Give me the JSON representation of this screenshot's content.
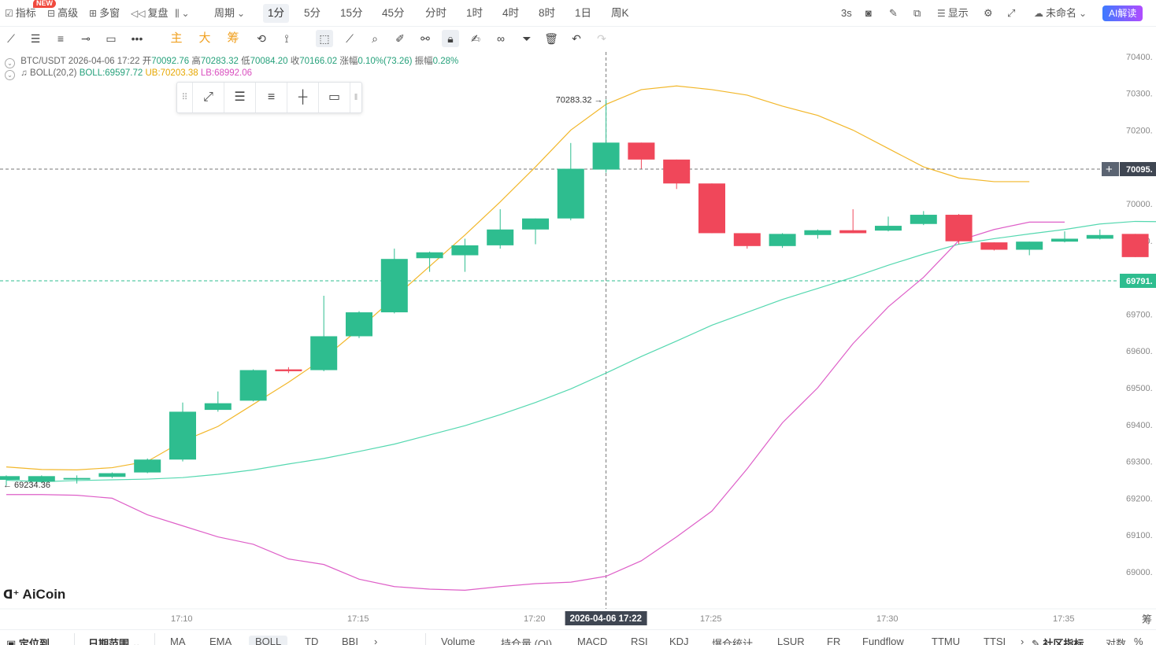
{
  "topbar": {
    "indicator": "指标",
    "new_badge": "NEW",
    "advanced": "高级",
    "multi_window": "多窗",
    "replay": "复盘",
    "period_label": "周期",
    "periods": [
      "1分",
      "5分",
      "15分",
      "45分",
      "分时",
      "1时",
      "4时",
      "8时",
      "1日",
      "周K"
    ],
    "active_period": "1分",
    "refresh": "3s",
    "display": "显示",
    "account": "未命名",
    "ai_button": "AI解读"
  },
  "toolbar2": {
    "main_label": "主",
    "big_label": "大",
    "chip_label": "筹"
  },
  "info": {
    "symbol": "BTC/USDT",
    "datetime": "2026-04-06 17:22",
    "open_label": "开",
    "open": "70092.76",
    "high_label": "高",
    "high": "70283.32",
    "low_label": "低",
    "low": "70084.20",
    "close_label": "收",
    "close": "70166.02",
    "change_label": "涨幅",
    "change": "0.10%(73.26)",
    "amp_label": "振幅",
    "amp": "0.28%",
    "boll_name": "BOLL(20,2)",
    "boll_mid": "BOLL:69597.72",
    "boll_ub": "UB:70203.38",
    "boll_lb": "LB:68992.06"
  },
  "chart_data": {
    "type": "candlestick",
    "symbol": "BTC/USDT",
    "ylim": [
      68900,
      70440
    ],
    "yticks": [
      70400,
      70300,
      70200,
      70000,
      69900,
      69700,
      69600,
      69500,
      69400,
      69300,
      69200,
      69100,
      69000
    ],
    "ytick_labels": [
      "70400.",
      "70300.",
      "70200.",
      "70000.",
      "69900.",
      "69700.",
      "69600.",
      "69500.",
      "69400.",
      "69300.",
      "69200.",
      "69100.",
      "69000."
    ],
    "xticks": [
      "17:10",
      "17:15",
      "17:20",
      "17:25",
      "17:30",
      "17:35"
    ],
    "crosshair_time": "2026-04-06 17:22",
    "crosshair_price_label": "70095.",
    "last_price_label": "69791.",
    "high_marker": "70283.32",
    "low_marker": "69234.36",
    "candles": [
      {
        "o": 69250,
        "h": 69262,
        "l": 69234.36,
        "c": 69260
      },
      {
        "o": 69245,
        "h": 69262,
        "l": 69242,
        "c": 69260
      },
      {
        "o": 69252,
        "h": 69262,
        "l": 69240,
        "c": 69255
      },
      {
        "o": 69258,
        "h": 69270,
        "l": 69255,
        "c": 69268
      },
      {
        "o": 69270,
        "h": 69308,
        "l": 69268,
        "c": 69305
      },
      {
        "o": 69305,
        "h": 69460,
        "l": 69300,
        "c": 69435
      },
      {
        "o": 69440,
        "h": 69490,
        "l": 69435,
        "c": 69458
      },
      {
        "o": 69465,
        "h": 69550,
        "l": 69463,
        "c": 69548
      },
      {
        "o": 69550,
        "h": 69556,
        "l": 69540,
        "c": 69545
      },
      {
        "o": 69548,
        "h": 69750,
        "l": 69545,
        "c": 69640
      },
      {
        "o": 69640,
        "h": 69708,
        "l": 69635,
        "c": 69705
      },
      {
        "o": 69705,
        "h": 69878,
        "l": 69702,
        "c": 69850
      },
      {
        "o": 69852,
        "h": 69870,
        "l": 69815,
        "c": 69868
      },
      {
        "o": 69860,
        "h": 69905,
        "l": 69815,
        "c": 69887
      },
      {
        "o": 69887,
        "h": 69985,
        "l": 69878,
        "c": 69930
      },
      {
        "o": 69930,
        "h": 69960,
        "l": 69890,
        "c": 69960
      },
      {
        "o": 69960,
        "h": 70165,
        "l": 69955,
        "c": 70095
      },
      {
        "o": 70092.76,
        "h": 70283.32,
        "l": 70084.2,
        "c": 70166.02
      },
      {
        "o": 70166,
        "h": 70166,
        "l": 70095,
        "c": 70120
      },
      {
        "o": 70120,
        "h": 70120,
        "l": 70040,
        "c": 70055
      },
      {
        "o": 70055,
        "h": 70055,
        "l": 69920,
        "c": 69920
      },
      {
        "o": 69920,
        "h": 69920,
        "l": 69878,
        "c": 69885
      },
      {
        "o": 69885,
        "h": 69920,
        "l": 69880,
        "c": 69918
      },
      {
        "o": 69915,
        "h": 69930,
        "l": 69905,
        "c": 69928
      },
      {
        "o": 69928,
        "h": 69985,
        "l": 69920,
        "c": 69920
      },
      {
        "o": 69927,
        "h": 69965,
        "l": 69925,
        "c": 69940
      },
      {
        "o": 69945,
        "h": 69980,
        "l": 69942,
        "c": 69970
      },
      {
        "o": 69970,
        "h": 69972,
        "l": 69890,
        "c": 69898
      },
      {
        "o": 69895,
        "h": 69895,
        "l": 69873,
        "c": 69875
      },
      {
        "o": 69875,
        "h": 69897,
        "l": 69860,
        "c": 69897
      },
      {
        "o": 69897,
        "h": 69925,
        "l": 69895,
        "c": 69905
      },
      {
        "o": 69905,
        "h": 69930,
        "l": 69903,
        "c": 69915
      },
      {
        "o": 69918,
        "h": 69918,
        "l": 69855,
        "c": 69855
      }
    ],
    "boll_mid": [
      69249,
      69245,
      69248,
      69250,
      69252,
      69256,
      69265,
      69277,
      69293,
      69308,
      69327,
      69347,
      69372,
      69397,
      69427,
      69460,
      69497,
      69540,
      69585,
      69627,
      69670,
      69705,
      69740,
      69770,
      69800,
      69833,
      69863,
      69890,
      69905,
      69918,
      69930,
      69945,
      69952,
      69951
    ],
    "boll_ub": [
      69285,
      69278,
      69277,
      69283,
      69300,
      69355,
      69395,
      69455,
      69515,
      69580,
      69660,
      69745,
      69830,
      69915,
      70005,
      70100,
      70200,
      70270,
      70310,
      70320,
      70310,
      70295,
      70265,
      70240,
      70200,
      70150,
      70100,
      70070,
      70060,
      70060
    ],
    "boll_lb": [
      69210,
      69210,
      69208,
      69200,
      69155,
      69125,
      69095,
      69075,
      69035,
      69020,
      68980,
      68960,
      68953,
      68950,
      68960,
      68968,
      68972,
      68988,
      69030,
      69095,
      69165,
      69280,
      69405,
      69500,
      69620,
      69720,
      69800,
      69900,
      69930,
      69950,
      69950
    ],
    "colors": {
      "up": "#2ebd8f",
      "down": "#f0475a",
      "mid": "#55d8b0",
      "ub": "#f2b72a",
      "lb": "#de5fc8"
    }
  },
  "logo": "AiCoin",
  "bottombar": {
    "locate": "定位到...",
    "date_range": "日期范围",
    "indicators": [
      "MA",
      "EMA",
      "BOLL",
      "TD",
      "BBI"
    ],
    "active_indicator": "BOLL",
    "subs": [
      "Volume",
      "持仓量 (OI)",
      "MACD",
      "RSI",
      "KDJ",
      "爆仓统计",
      "LSUR",
      "FR",
      "Fundflow",
      "TTMU",
      "TTSI"
    ],
    "community": "社区指标",
    "log": "对数",
    "pct": "%"
  },
  "right_edge_label": "筹"
}
